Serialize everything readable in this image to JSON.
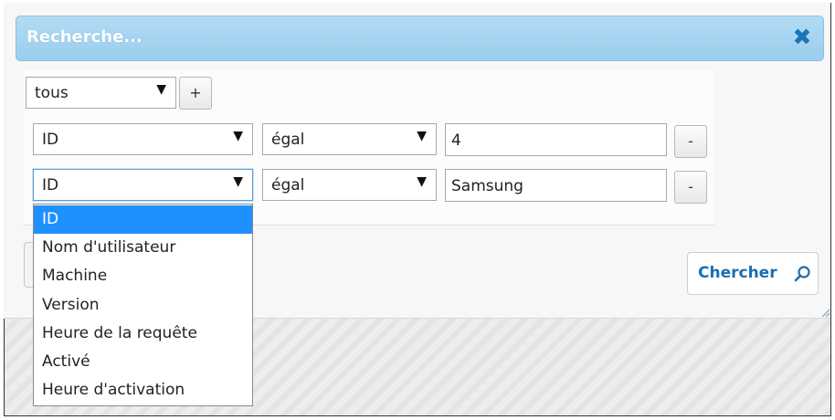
{
  "dialog": {
    "title": "Recherche...",
    "close_icon": "close-icon",
    "accent": "#1e90ff"
  },
  "top": {
    "match_select": "tous",
    "add_label": "+"
  },
  "rows": [
    {
      "field": "ID",
      "operator": "égal",
      "value": "4",
      "remove_label": "-"
    },
    {
      "field": "ID",
      "operator": "égal",
      "value": "Samsung",
      "remove_label": "-"
    }
  ],
  "search_button": {
    "label": "Chercher",
    "icon": "search-icon"
  },
  "dropdown": {
    "selected": "ID",
    "options": [
      "ID",
      "Nom d'utilisateur",
      "Machine",
      "Version",
      "Heure de la requête",
      "Activé",
      "Heure d'activation"
    ]
  }
}
